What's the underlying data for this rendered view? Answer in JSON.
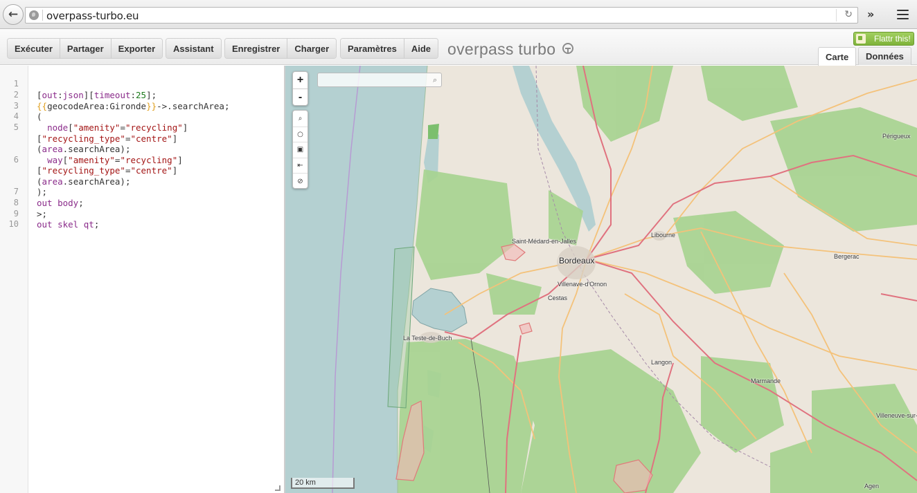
{
  "browser": {
    "url": "overpass-turbo.eu"
  },
  "toolbar": {
    "groups": [
      [
        "Exécuter",
        "Partager",
        "Exporter"
      ],
      [
        "Assistant"
      ],
      [
        "Enregistrer",
        "Charger"
      ],
      [
        "Paramètres",
        "Aide"
      ]
    ],
    "brand": "overpass turbo",
    "flattr_label": "Flattr this!",
    "tabs": [
      "Carte",
      "Données"
    ],
    "active_tab": "Carte"
  },
  "editor": {
    "line_numbers": [
      "1",
      "2",
      "3",
      "4",
      "5",
      "",
      "",
      "6",
      "",
      "",
      "7",
      "8",
      "9",
      "10"
    ],
    "lines": [
      "",
      "[out:json][timeout:25];",
      "{{geocodeArea:Gironde}}->.searchArea;",
      "(",
      "  node[\"amenity\"=\"recycling\"]",
      "[\"recycling_type\"=\"centre\"]",
      "(area.searchArea);",
      "  way[\"amenity\"=\"recycling\"]",
      "[\"recycling_type\"=\"centre\"]",
      "(area.searchArea);",
      ");",
      "out body;",
      ">;",
      "out skel qt;"
    ]
  },
  "map": {
    "zoom_in": "+",
    "zoom_out": "-",
    "search_placeholder": "",
    "scale": "20 km",
    "places": [
      {
        "name": "Bordeaux",
        "big": true
      },
      {
        "name": "Saint-Médard-en-Jalles"
      },
      {
        "name": "Villenave-d'Ornon"
      },
      {
        "name": "Cestas"
      },
      {
        "name": "La Teste-de-Buch"
      },
      {
        "name": "Libourne"
      },
      {
        "name": "Bergerac"
      },
      {
        "name": "Langon"
      },
      {
        "name": "Marmande"
      },
      {
        "name": "Périgueux"
      },
      {
        "name": "Villeneuve-sur-"
      },
      {
        "name": "Agen"
      }
    ],
    "colors": {
      "sea": "#b4d0d1",
      "land": "#ece6dc",
      "forest": "#a6d38f",
      "motorway": "#e0727f",
      "primary": "#f4c27a",
      "highlight": "#e88a8a"
    }
  }
}
